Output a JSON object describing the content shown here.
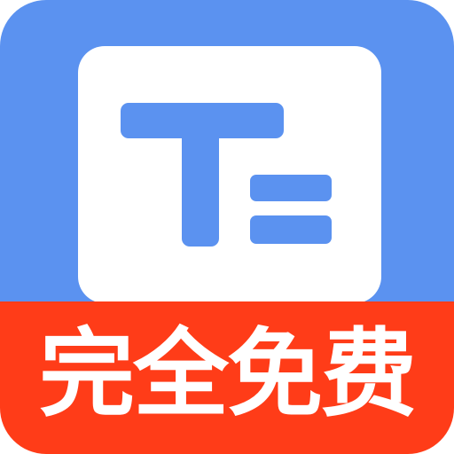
{
  "icon": {
    "logo": "text-editor-t-icon",
    "banner_text": "完全免费"
  },
  "colors": {
    "blue": "#5B92F0",
    "logo_blue": "#5B92F0",
    "banner_red": "#FF3C18",
    "white": "#FFFFFF"
  }
}
